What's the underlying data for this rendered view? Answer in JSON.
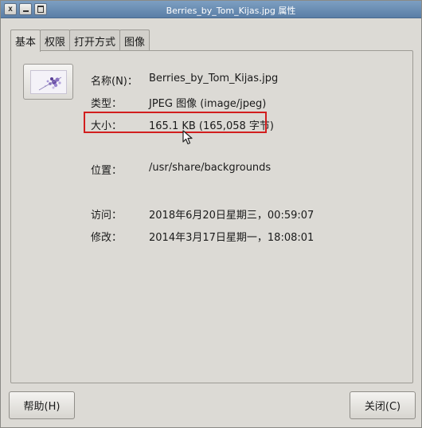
{
  "window": {
    "title": "Berries_by_Tom_Kijas.jpg 属性"
  },
  "tabs": [
    {
      "label": "基本",
      "active": true
    },
    {
      "label": "权限",
      "active": false
    },
    {
      "label": "打开方式",
      "active": false
    },
    {
      "label": "图像",
      "active": false
    }
  ],
  "info": {
    "name_label": "名称(N)：",
    "name_value": "Berries_by_Tom_Kijas.jpg",
    "type_label": "类型：",
    "type_value": "JPEG 图像 (image/jpeg)",
    "size_label": "大小：",
    "size_value": "165.1 KB (165,058 字节)",
    "location_label": "位置：",
    "location_value": "/usr/share/backgrounds",
    "accessed_label": "访问：",
    "accessed_value": "2018年6月20日星期三，00:59:07",
    "modified_label": "修改：",
    "modified_value": "2014年3月17日星期一，18:08:01"
  },
  "buttons": {
    "help": "帮助(H)",
    "close": "关闭(C)"
  },
  "colors": {
    "highlight": "#d21e1e",
    "titlebar": "#6a8db4"
  }
}
